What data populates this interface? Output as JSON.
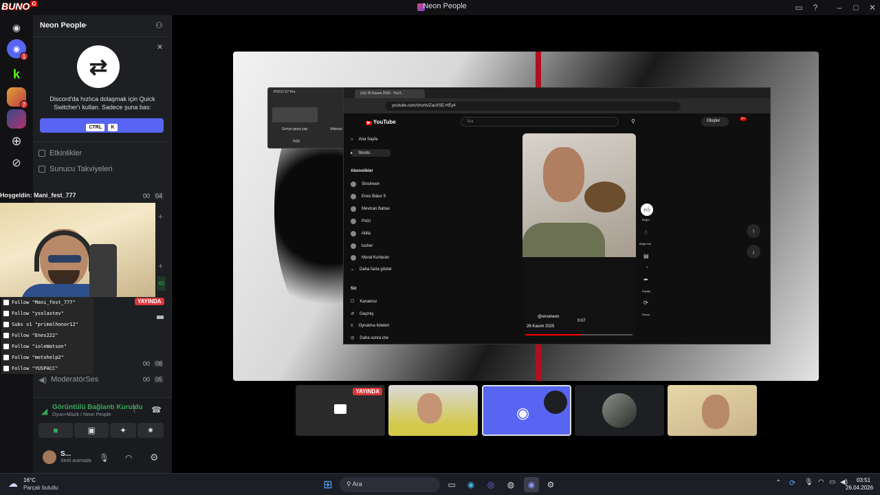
{
  "window": {
    "title": "Neon People",
    "logo": "BUNO"
  },
  "server": {
    "name": "Neon People",
    "quick_switcher": {
      "text": "Discord'da hızlıca dolaşmak için Quick Switcher'ı kullan. Sadece şuna bas:",
      "key1": "CTRL",
      "key2": "K"
    },
    "channels": [
      {
        "label": "Etkinlikler"
      },
      {
        "label": "Sunucu Takviyeleri"
      },
      {
        "label": "ModeratörSes",
        "count1": "00",
        "count2": "05"
      }
    ],
    "counts": {
      "row1a": "00",
      "row1b": "04",
      "row2a": "00",
      "row2b": "08",
      "side": "45"
    }
  },
  "stream_overlay": {
    "welcome": "Hoşgeldin: Mani_fest_777",
    "follows": [
      "Follow \"Mani_fest_777\"",
      "Follow \"ysolastev\"",
      "Subs x1 \"primalhonor12\"",
      "Follow \"Enes222\"",
      "Follow \"ioleWatson\"",
      "Follow \"metohelp2\"",
      "Follow \"YUSPACC\""
    ],
    "live_label": "YAYINDA"
  },
  "voice": {
    "status": "Görüntülü Bağlantı Kuruldu",
    "channel": "Oyun+Müzik / Neon People"
  },
  "user": {
    "name": "S...",
    "status": "Sesli aramada"
  },
  "browser": {
    "tab": "(16) 26 Kasım 2025 - YouT...",
    "url": "youtube.com/shorts/ZasXSE-HEy4",
    "search_placeholder": "Ara",
    "create": "Oluştur",
    "notif_count": "9+",
    "nav": [
      "Ana Sayfa",
      "Shorts"
    ],
    "subs_title": "Abonelikler",
    "subs": [
      "Sinsineon",
      "Enes Batur S",
      "Mevlcan Bahav",
      "Polzi",
      "Atilla",
      "lusher",
      "Murat Kurtaran"
    ],
    "show_more": "Daha fazla göster",
    "you_title": "Siz",
    "you": [
      "Kanalınız",
      "Geçmiş",
      "Oynatma listeleri",
      "Daha sonra izle"
    ],
    "channel": "@sinsineon",
    "date": "26 Kasım 2025",
    "time": "0:07",
    "progress": 0.52,
    "actions": [
      "Beğen",
      "Beğenme",
      "2",
      "Paylaş",
      "Remix"
    ]
  },
  "poco": {
    "title": "POCO X7 Pro",
    "back": "Geriye geçiş yap",
    "videos": "Videoyu",
    "battery": "%26"
  },
  "taskbar": {
    "weather_temp": "16°C",
    "weather_desc": "Parçalı bulutlu",
    "search": "Ara",
    "time": "03:51",
    "date": "26.04.2026"
  }
}
